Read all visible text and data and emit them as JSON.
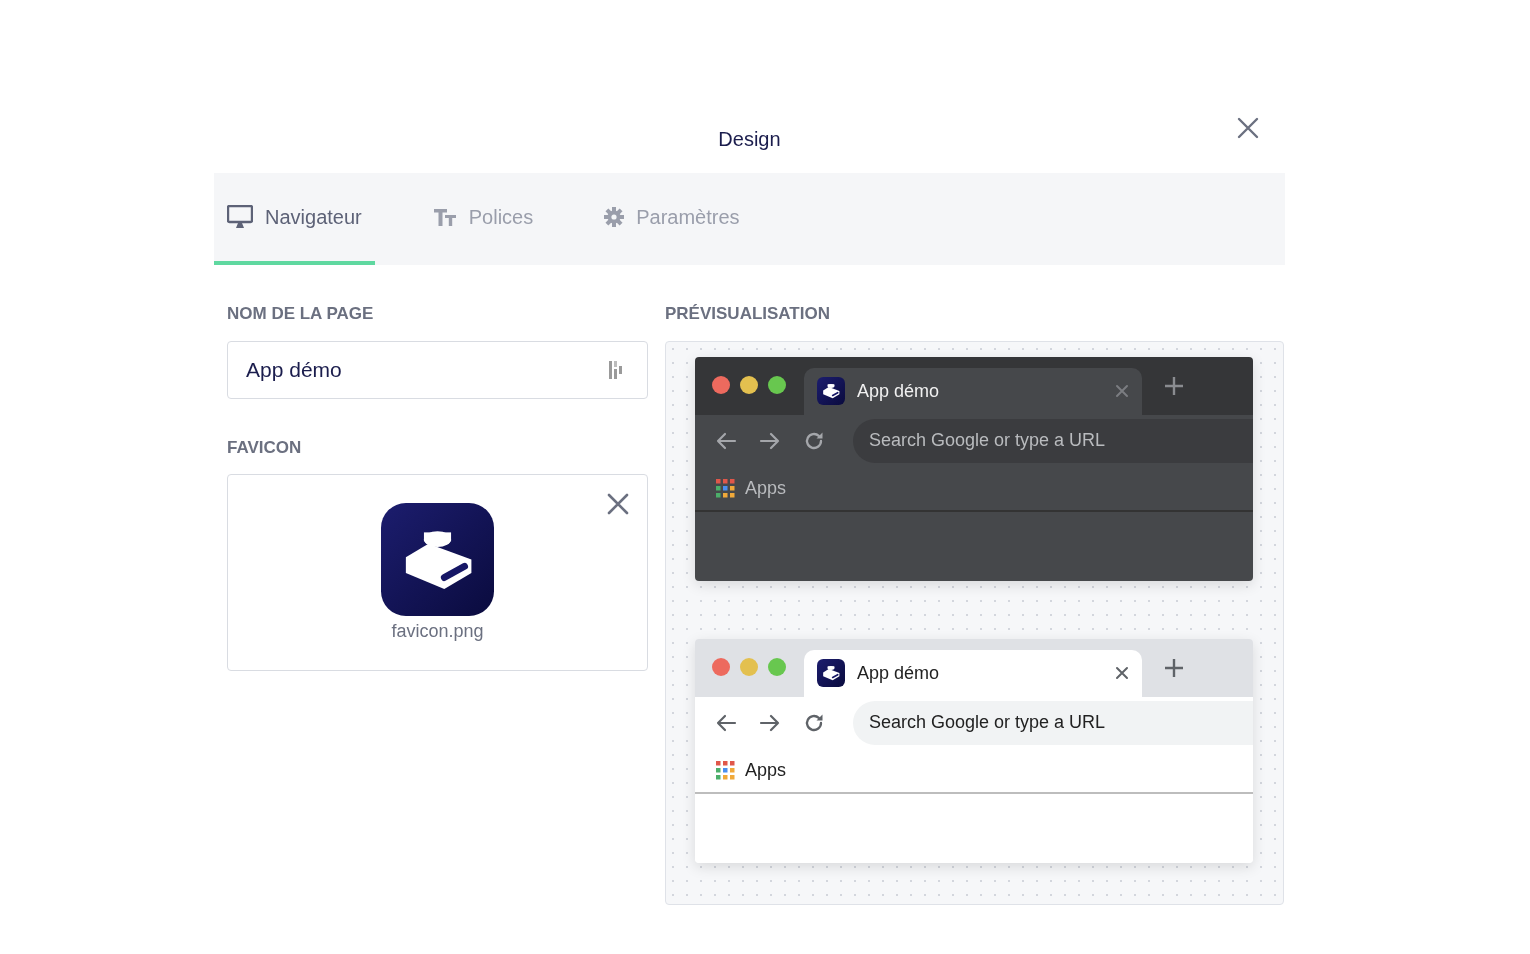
{
  "dialog": {
    "title": "Design"
  },
  "tabs": [
    {
      "label": "Navigateur",
      "kind": "monitor",
      "selected": true
    },
    {
      "label": "Polices",
      "kind": "fonts",
      "selected": false
    },
    {
      "label": "Paramètres",
      "kind": "settings",
      "selected": false
    }
  ],
  "page_name": {
    "label": "NOM DE LA PAGE",
    "value": "App démo"
  },
  "favicon": {
    "label": "FAVICON",
    "filename": "favicon.png"
  },
  "preview": {
    "label": "PRÉVISUALISATION",
    "browsers": [
      {
        "kind": "dark",
        "tab_title": "App démo",
        "address_placeholder": "Search Google or type a URL",
        "bookmark": "Apps"
      },
      {
        "kind": "light",
        "tab_title": "App démo",
        "address_placeholder": "Search Google or type a URL",
        "bookmark": "Apps"
      }
    ]
  }
}
